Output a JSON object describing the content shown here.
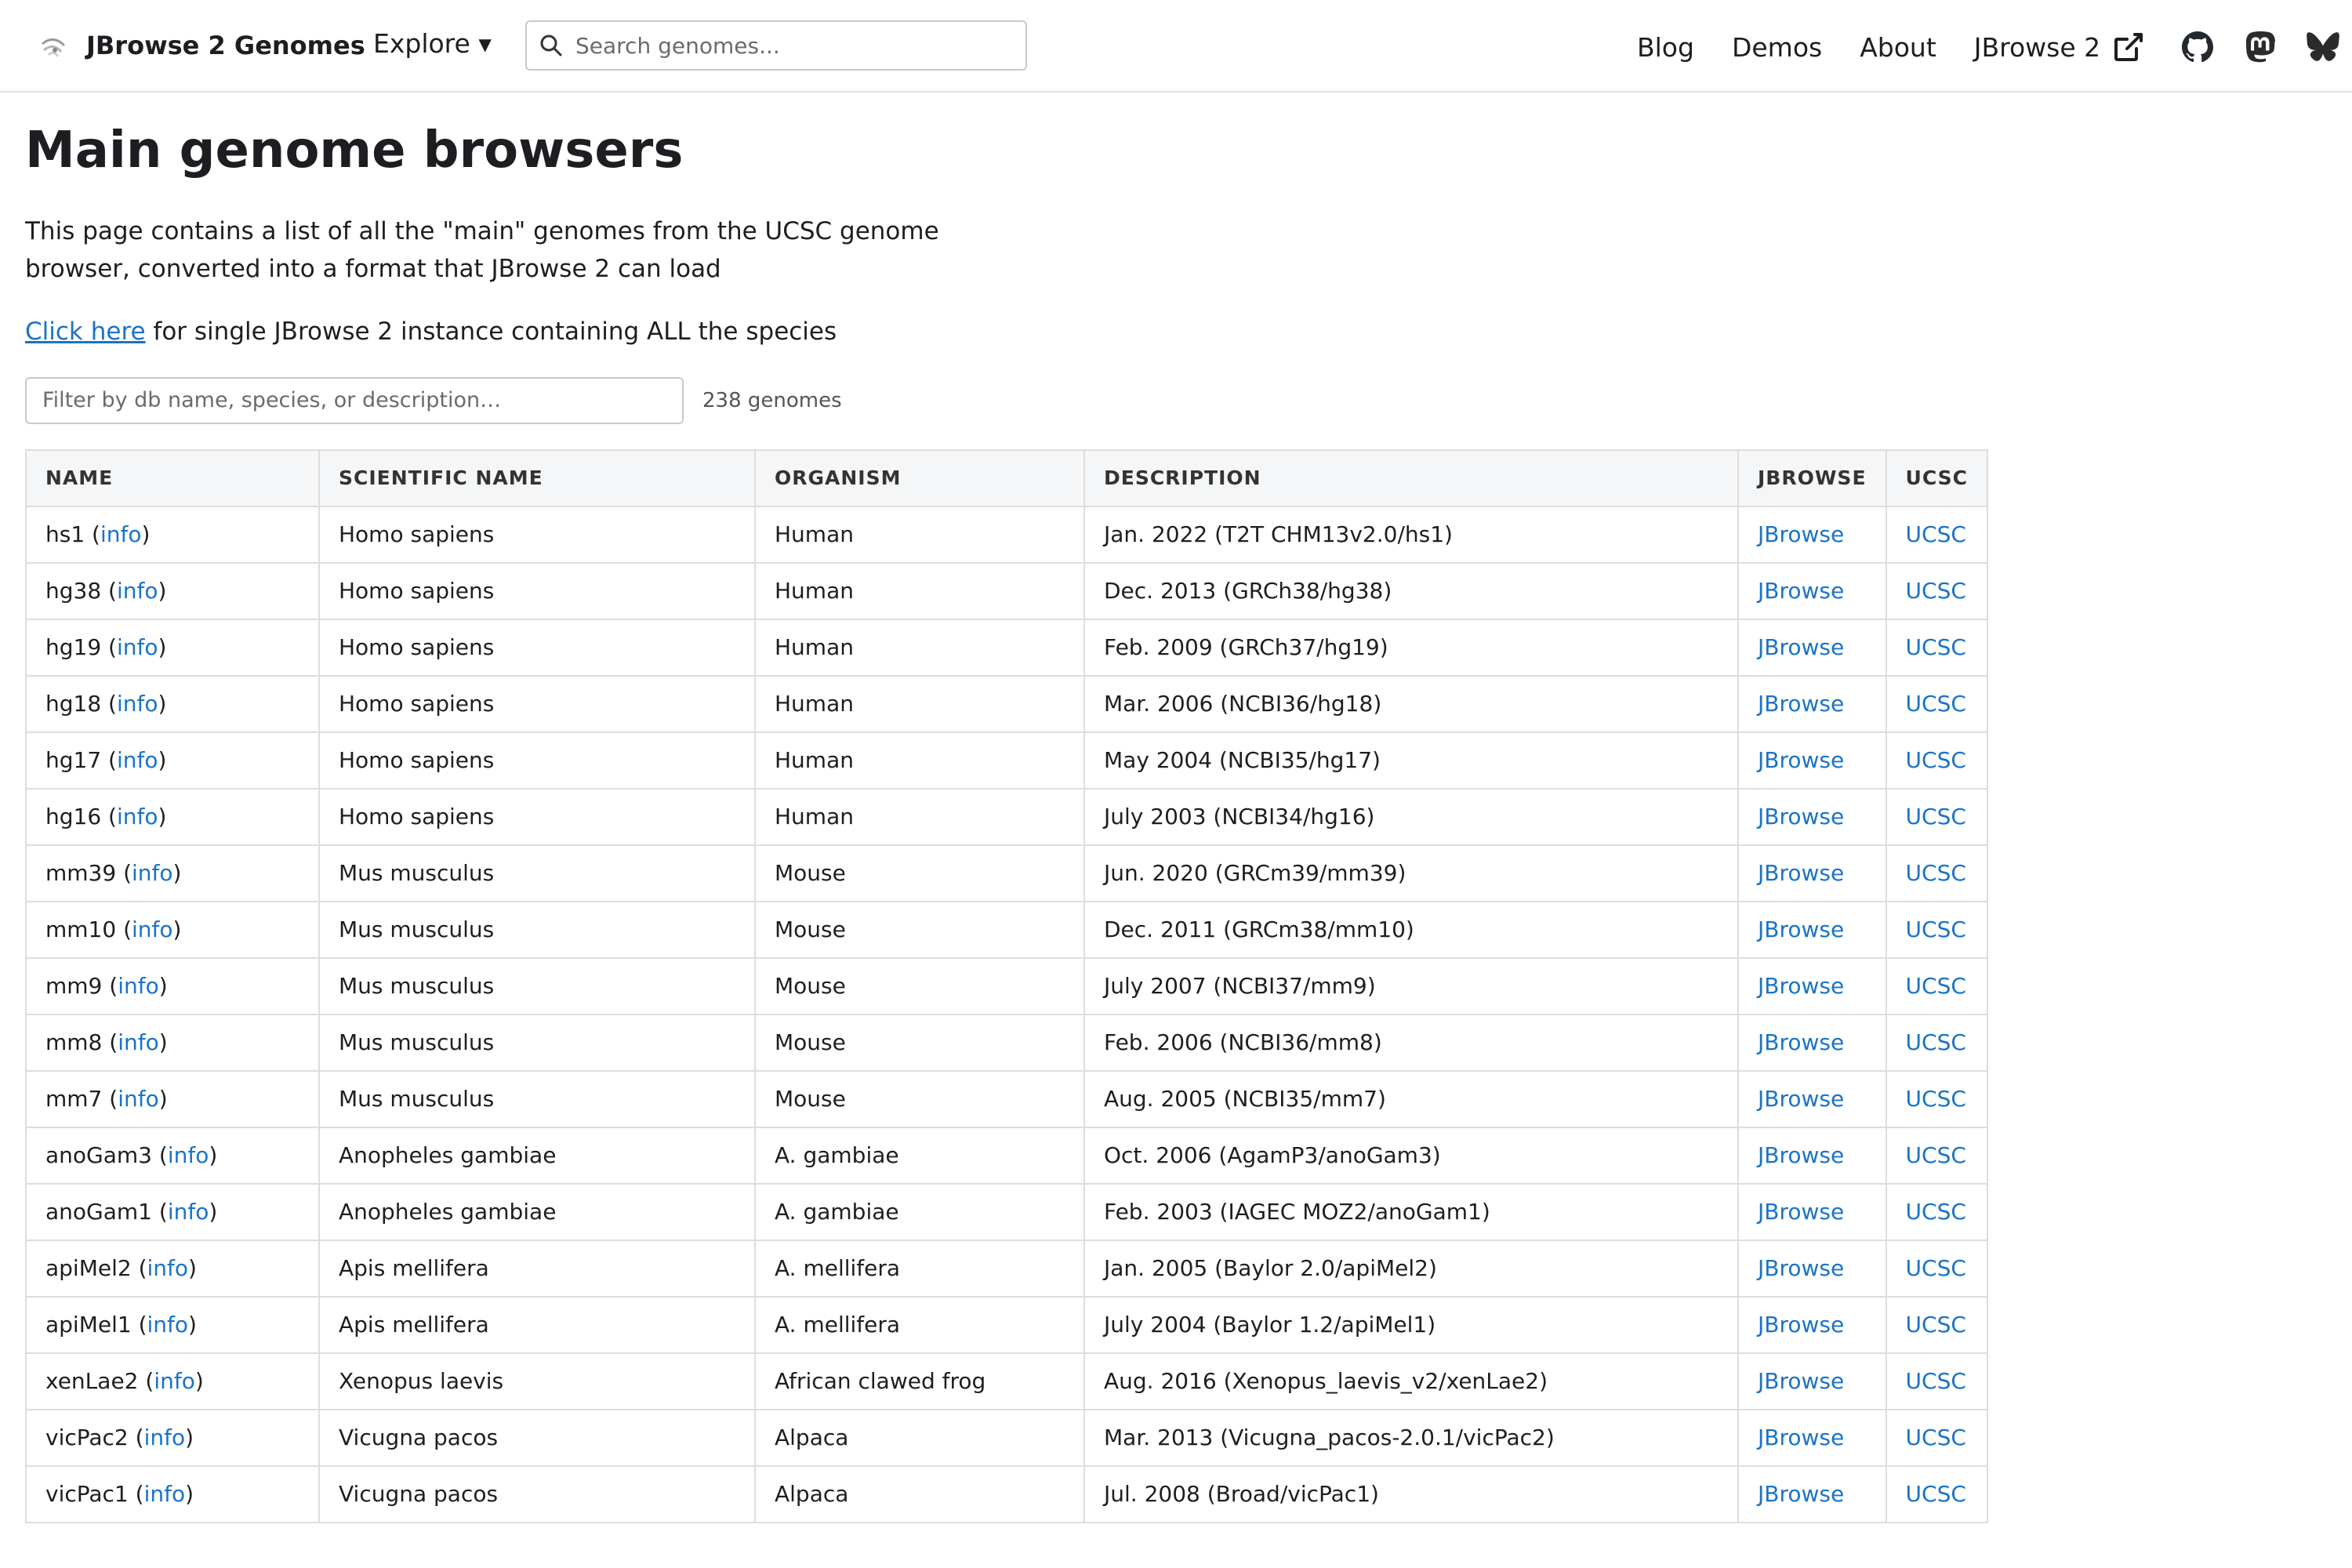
{
  "nav": {
    "brand": "JBrowse 2 Genomes",
    "explore": "Explore ▾",
    "search_placeholder": "Search genomes...",
    "links": [
      "Blog",
      "Demos",
      "About"
    ],
    "external_link": "JBrowse 2",
    "icons": [
      "external-link-icon",
      "github-icon",
      "mastodon-icon",
      "bluesky-icon"
    ]
  },
  "page": {
    "title": "Main genome browsers",
    "intro": "This page contains a list of all the \"main\" genomes from the UCSC genome browser, converted into a format that JBrowse 2 can load",
    "click_link": "Click here",
    "click_rest": " for single JBrowse 2 instance containing ALL the species",
    "filter_placeholder": "Filter by db name, species, or description…",
    "genome_count": "238 genomes"
  },
  "table": {
    "headers": [
      "NAME",
      "SCIENTIFIC NAME",
      "ORGANISM",
      "DESCRIPTION",
      "JBROWSE",
      "UCSC"
    ],
    "info_label": "info",
    "jbrowse_label": "JBrowse",
    "ucsc_label": "UCSC",
    "rows": [
      {
        "name": "hs1",
        "sci": "Homo sapiens",
        "org": "Human",
        "desc": "Jan. 2022 (T2T CHM13v2.0/hs1)"
      },
      {
        "name": "hg38",
        "sci": "Homo sapiens",
        "org": "Human",
        "desc": "Dec. 2013 (GRCh38/hg38)"
      },
      {
        "name": "hg19",
        "sci": "Homo sapiens",
        "org": "Human",
        "desc": "Feb. 2009 (GRCh37/hg19)"
      },
      {
        "name": "hg18",
        "sci": "Homo sapiens",
        "org": "Human",
        "desc": "Mar. 2006 (NCBI36/hg18)"
      },
      {
        "name": "hg17",
        "sci": "Homo sapiens",
        "org": "Human",
        "desc": "May 2004 (NCBI35/hg17)"
      },
      {
        "name": "hg16",
        "sci": "Homo sapiens",
        "org": "Human",
        "desc": "July 2003 (NCBI34/hg16)"
      },
      {
        "name": "mm39",
        "sci": "Mus musculus",
        "org": "Mouse",
        "desc": "Jun. 2020 (GRCm39/mm39)"
      },
      {
        "name": "mm10",
        "sci": "Mus musculus",
        "org": "Mouse",
        "desc": "Dec. 2011 (GRCm38/mm10)"
      },
      {
        "name": "mm9",
        "sci": "Mus musculus",
        "org": "Mouse",
        "desc": "July 2007 (NCBI37/mm9)"
      },
      {
        "name": "mm8",
        "sci": "Mus musculus",
        "org": "Mouse",
        "desc": "Feb. 2006 (NCBI36/mm8)"
      },
      {
        "name": "mm7",
        "sci": "Mus musculus",
        "org": "Mouse",
        "desc": "Aug. 2005 (NCBI35/mm7)"
      },
      {
        "name": "anoGam3",
        "sci": "Anopheles gambiae",
        "org": "A. gambiae",
        "desc": "Oct. 2006 (AgamP3/anoGam3)"
      },
      {
        "name": "anoGam1",
        "sci": "Anopheles gambiae",
        "org": "A. gambiae",
        "desc": "Feb. 2003 (IAGEC MOZ2/anoGam1)"
      },
      {
        "name": "apiMel2",
        "sci": "Apis mellifera",
        "org": "A. mellifera",
        "desc": "Jan. 2005 (Baylor 2.0/apiMel2)"
      },
      {
        "name": "apiMel1",
        "sci": "Apis mellifera",
        "org": "A. mellifera",
        "desc": "July 2004 (Baylor 1.2/apiMel1)"
      },
      {
        "name": "xenLae2",
        "sci": "Xenopus laevis",
        "org": "African clawed frog",
        "desc": "Aug. 2016 (Xenopus_laevis_v2/xenLae2)"
      },
      {
        "name": "vicPac2",
        "sci": "Vicugna pacos",
        "org": "Alpaca",
        "desc": "Mar. 2013 (Vicugna_pacos-2.0.1/vicPac2)"
      },
      {
        "name": "vicPac1",
        "sci": "Vicugna pacos",
        "org": "Alpaca",
        "desc": "Jul. 2008 (Broad/vicPac1)"
      }
    ]
  }
}
